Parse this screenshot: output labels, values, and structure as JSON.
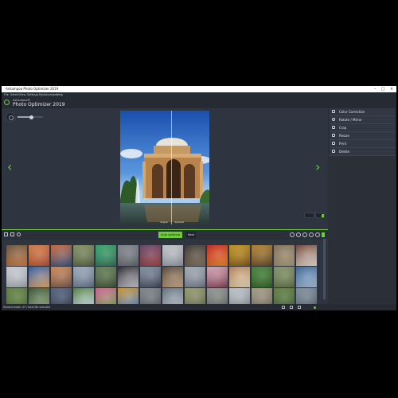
{
  "window": {
    "title": "Ashampoo Photo Optimizer 2019",
    "min_symbol": "–",
    "max_symbol": "□",
    "close_symbol": "×"
  },
  "menu": [
    "File",
    "Select",
    "View",
    "Settings",
    "MyAshampoo",
    "Help"
  ],
  "app": {
    "brand_small": "Ashampoo®",
    "brand_big": "Photo Optimizer 2019"
  },
  "viewer": {
    "prev_icon": "chevron-left-icon",
    "next_icon": "chevron-right-icon",
    "prev_glyph": "‹",
    "next_glyph": "›",
    "original_label": "Original",
    "improved_label": "Improved",
    "zoom_level": 0.55
  },
  "sidebar": {
    "items": [
      {
        "label": "Color Correction",
        "icon": "color-correction-icon"
      },
      {
        "label": "Rotate / Mirror",
        "icon": "rotate-icon"
      },
      {
        "label": "Crop",
        "icon": "crop-icon"
      },
      {
        "label": "Resize",
        "icon": "resize-icon"
      },
      {
        "label": "Print",
        "icon": "print-icon"
      },
      {
        "label": "Delete",
        "icon": "delete-icon"
      }
    ]
  },
  "toolbar": {
    "tooltip": "Auto optimize",
    "next_label": "Next"
  },
  "thumbnails": [
    [
      "#6b5a44",
      "#c8733b"
    ],
    [
      "#e2844a",
      "#a84a2b"
    ],
    [
      "#d86e3c",
      "#2f4c7c"
    ],
    [
      "#8a9a6a",
      "#4e5a3a"
    ],
    [
      "#3ab070",
      "#2a6a50"
    ],
    [
      "#8a8f96",
      "#5a5e64"
    ],
    [
      "#6a4a70",
      "#9a3a3a"
    ],
    [
      "#cfd2d6",
      "#8a9098"
    ],
    [
      "#3c3a36",
      "#7a6a52"
    ],
    [
      "#d22a20",
      "#e07a20"
    ],
    [
      "#d0a020",
      "#7a5010"
    ],
    [
      "#c08a30",
      "#5a4020"
    ],
    [
      "#8a7a60",
      "#a09070"
    ],
    [
      "#7a4a3a",
      "#e0d8cc"
    ],
    [
      "#d8dce2",
      "#9aa0a8"
    ],
    [
      "#2f62b0",
      "#e0a060"
    ],
    [
      "#e0905a",
      "#6a5040"
    ],
    [
      "#aab6c8",
      "#5a6a80"
    ],
    [
      "#6a8a5a",
      "#3a4a30"
    ],
    [
      "#2a2a30",
      "#c0c0c8"
    ],
    [
      "#8a9ab0",
      "#3a4050"
    ],
    [
      "#5a4a3a",
      "#c0a080"
    ],
    [
      "#b0b8c0",
      "#6a7080"
    ],
    [
      "#e6b0c0",
      "#7a3a50"
    ],
    [
      "#c08a60",
      "#e0d0b0"
    ],
    [
      "#4a8a3a",
      "#2a5a20"
    ],
    [
      "#8a9a70",
      "#5a6a40"
    ],
    [
      "#3a6aa0",
      "#a0b8d0"
    ],
    [
      "#6a8a4a",
      "#4a6a2a"
    ],
    [
      "#3a5a3a",
      "#8aa070"
    ],
    [
      "#5a6a8a",
      "#2a3448"
    ],
    [
      "#5a8a4a",
      "#c8d8e8"
    ],
    [
      "#e06aa0",
      "#6a9a40"
    ],
    [
      "#e0a030",
      "#3a7ad0"
    ],
    [
      "#8a9098",
      "#4a5058"
    ],
    [
      "#6a7a8a",
      "#b0b8c0"
    ],
    [
      "#a0a878",
      "#5a5e40"
    ],
    [
      "#9aa0a0",
      "#5a5a50"
    ],
    [
      "#cfd5dc",
      "#7a8088"
    ],
    [
      "#b0a890",
      "#6a6050"
    ],
    [
      "#6a8a4a",
      "#3a5a2a"
    ],
    [
      "#8a9aa8",
      "#4a5868"
    ],
    [
      "#b0b8a8",
      "#6a7060"
    ],
    [
      "#8aa8b0",
      "#4a6a70"
    ],
    [
      "#7a8a6a",
      "#3a4a30"
    ],
    [
      "#9098a0",
      "#5a6068"
    ],
    [
      "#aab8c4",
      "#4a5a68"
    ]
  ],
  "status": {
    "text": "Marked folder: 47 / total file selected",
    "indicator_color": "#6ecb3c"
  },
  "colors": {
    "accent": "#6ecb3c",
    "bg": "#2e3440",
    "panel": "#2a2f38"
  }
}
